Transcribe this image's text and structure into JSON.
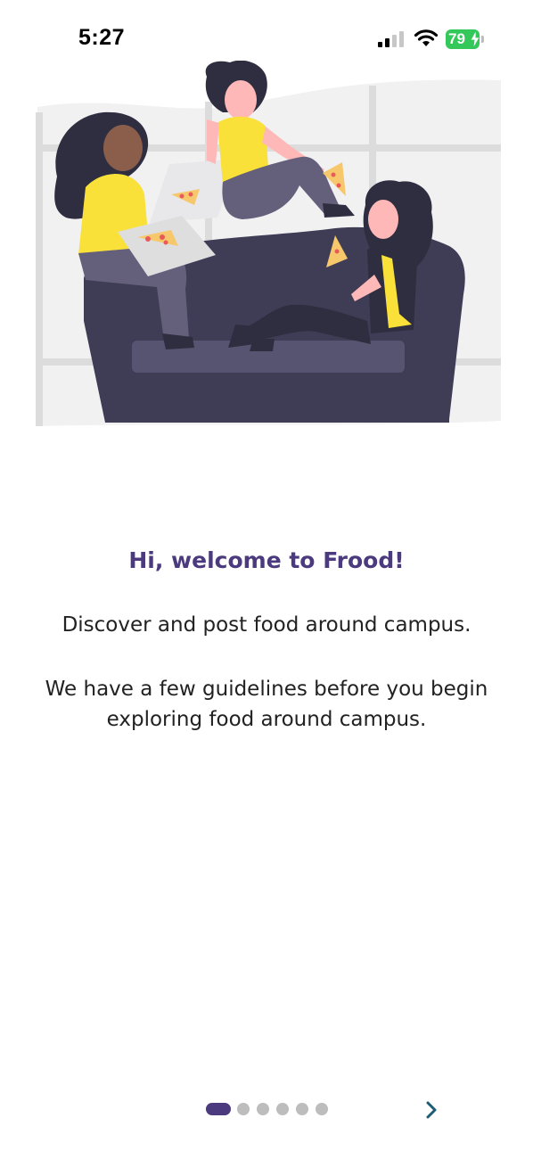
{
  "status": {
    "time": "5:27",
    "battery": "79"
  },
  "onboarding": {
    "title": "Hi, welcome to Frood!",
    "line1": "Discover and post food around campus.",
    "line2a": "We have a few guidelines before you begin",
    "line2b": "exploring food around campus."
  },
  "pager": {
    "total": 6,
    "active_index": 0
  },
  "icons": {
    "signal": "cellular-signal-icon",
    "wifi": "wifi-icon",
    "battery": "battery-charging-icon",
    "next": "chevron-right-icon"
  },
  "colors": {
    "accent": "#4b3a7e",
    "battery": "#34c759",
    "next_arrow": "#1a5d74",
    "dot_inactive": "#bdbdbd"
  }
}
